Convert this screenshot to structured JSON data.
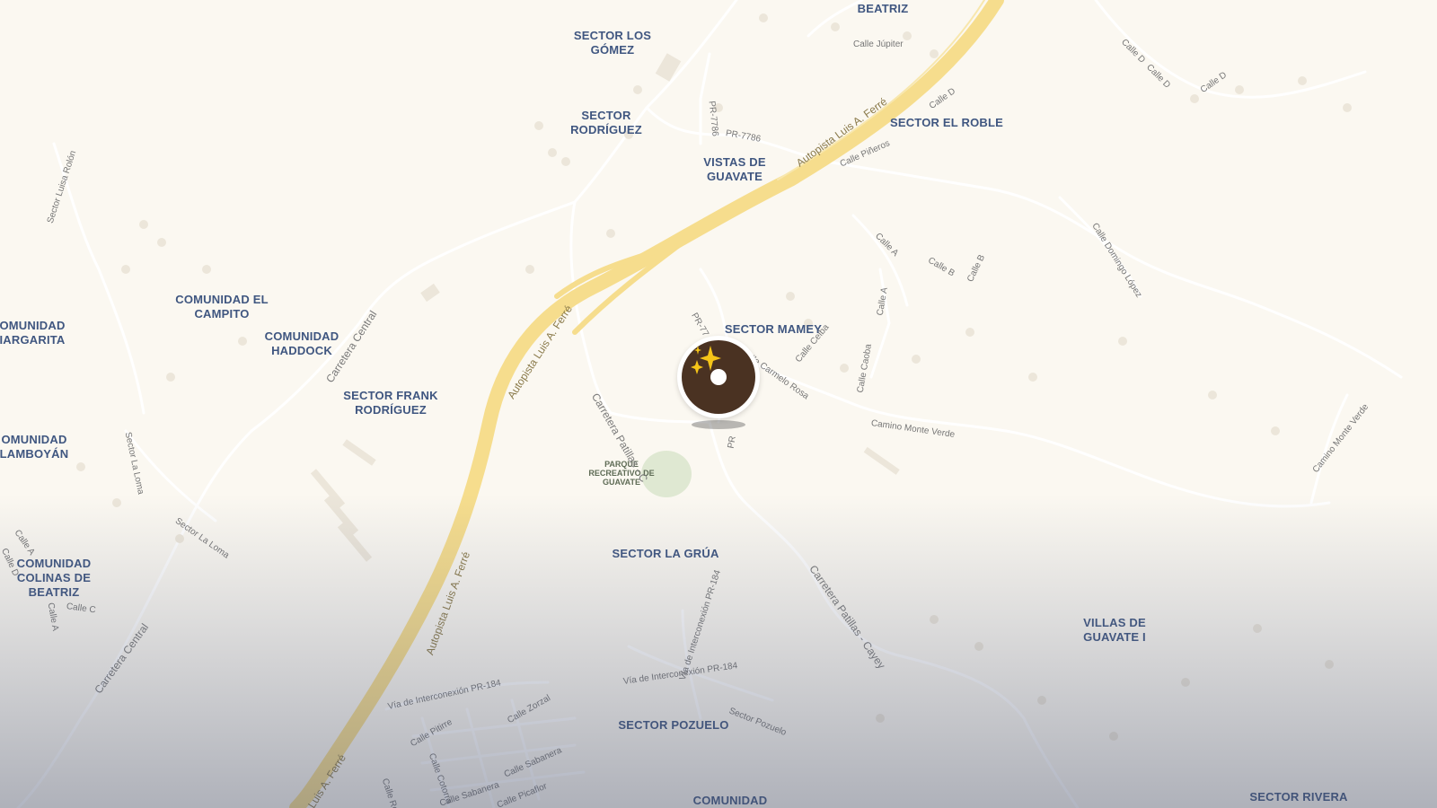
{
  "map": {
    "places": [
      {
        "id": "beatriz",
        "name": "BEATRIZ"
      },
      {
        "id": "los-gomez",
        "name": "SECTOR LOS\nGÓMEZ"
      },
      {
        "id": "rodriguez",
        "name": "SECTOR\nRODRÍGUEZ"
      },
      {
        "id": "el-roble",
        "name": "SECTOR EL ROBLE"
      },
      {
        "id": "vistas",
        "name": "VISTAS DE\nGUAVATE"
      },
      {
        "id": "el-campito",
        "name": "COMUNIDAD EL\nCAMPITO"
      },
      {
        "id": "margarita",
        "name": "OMUNIDAD\nIARGARITA"
      },
      {
        "id": "haddock",
        "name": "COMUNIDAD\nHADDOCK"
      },
      {
        "id": "mamey",
        "name": "SECTOR MAMEY"
      },
      {
        "id": "frank",
        "name": "SECTOR FRANK\nRODRÍGUEZ"
      },
      {
        "id": "lamboyan",
        "name": "OMUNIDAD\nLAMBOYÁN"
      },
      {
        "id": "colinas",
        "name": "COMUNIDAD\nCOLINAS DE\nBEATRIZ"
      },
      {
        "id": "la-grua",
        "name": "SECTOR LA GRÚA"
      },
      {
        "id": "villas",
        "name": "VILLAS DE\nGUAVATE I"
      },
      {
        "id": "pozuelo",
        "name": "SECTOR POZUELO"
      },
      {
        "id": "comunidad-bottom",
        "name": "COMUNIDAD"
      },
      {
        "id": "rivera",
        "name": "SECTOR RIVERA"
      }
    ],
    "poi": {
      "name": "PARQUE\nRECREATIVO DE\nGUAVATE"
    },
    "highways": [
      {
        "id": "hw1",
        "name": "Autopista Luis A. Ferré"
      },
      {
        "id": "hw2",
        "name": "Autopista Luis A. Ferré"
      },
      {
        "id": "hw3",
        "name": "Autopista Luis A. Ferré"
      },
      {
        "id": "hw4",
        "name": "Luis A. Ferré"
      }
    ],
    "major_roads": [
      {
        "id": "cc1",
        "name": "Carretera Central"
      },
      {
        "id": "cc2",
        "name": "Carretera Central"
      },
      {
        "id": "cp1",
        "name": "Carretera Patillas - C"
      },
      {
        "id": "cp2",
        "name": "Carretera Patillas - Cayey"
      }
    ],
    "streets": [
      {
        "id": "s1",
        "name": "Calle Júpiter"
      },
      {
        "id": "s2",
        "name": "Calle D"
      },
      {
        "id": "s3",
        "name": "Calle D"
      },
      {
        "id": "s4",
        "name": "Calle D"
      },
      {
        "id": "s5",
        "name": "Calle D"
      },
      {
        "id": "s6",
        "name": "PR-7786"
      },
      {
        "id": "s7",
        "name": "PR-7786"
      },
      {
        "id": "s8",
        "name": "Calle Piñeros"
      },
      {
        "id": "s9",
        "name": "Sector Luisa Rolón"
      },
      {
        "id": "s10",
        "name": "Calle A"
      },
      {
        "id": "s11",
        "name": "Calle B"
      },
      {
        "id": "s12",
        "name": "Calle B"
      },
      {
        "id": "s13",
        "name": "Calle Domingo López"
      },
      {
        "id": "s14",
        "name": "Calle A"
      },
      {
        "id": "s15",
        "name": "PR-77"
      },
      {
        "id": "s16",
        "name": "Calle Ceiba"
      },
      {
        "id": "s17",
        "name": "Calle Carmelo Rosa"
      },
      {
        "id": "s18",
        "name": "Calle Caoba"
      },
      {
        "id": "s19",
        "name": "Camino Monte Verde"
      },
      {
        "id": "s20",
        "name": "Camino Monte Verde"
      },
      {
        "id": "s21",
        "name": "Sector La Loma"
      },
      {
        "id": "s22",
        "name": "Sector La Loma"
      },
      {
        "id": "s23",
        "name": "Calle A"
      },
      {
        "id": "s24",
        "name": "Calle D"
      },
      {
        "id": "s25",
        "name": "Calle C"
      },
      {
        "id": "s26",
        "name": "Calle A"
      },
      {
        "id": "s27",
        "name": "PR"
      },
      {
        "id": "s28",
        "name": "Vía de Interconexión PR-184"
      },
      {
        "id": "s29",
        "name": "Vía de Interconexión PR-184"
      },
      {
        "id": "s30",
        "name": "Vía de Interconexión PR-184"
      },
      {
        "id": "s31",
        "name": "Sector Pozuelo"
      },
      {
        "id": "s32",
        "name": "Calle Zorzal"
      },
      {
        "id": "s33",
        "name": "Calle Pitirre"
      },
      {
        "id": "s34",
        "name": "Calle Cotorra"
      },
      {
        "id": "s35",
        "name": "Calle Sabanera"
      },
      {
        "id": "s36",
        "name": "Calle Sabanera"
      },
      {
        "id": "s37",
        "name": "Calle Picaflor"
      },
      {
        "id": "s38",
        "name": "Calle Reina"
      }
    ],
    "marker": {
      "icon": "sparkles-icon"
    },
    "colors": {
      "land": "#fbf8f1",
      "highway": "#f6dd8d",
      "road": "#ffffff",
      "label": "#3f5680",
      "park": "#dfe8d2",
      "marker": "#4a3222",
      "fade": "#5a6482"
    }
  }
}
